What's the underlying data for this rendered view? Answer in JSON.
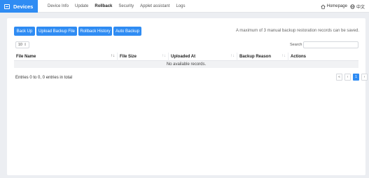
{
  "header": {
    "brand": "Devices",
    "nav": [
      "Device Info",
      "Update",
      "Rollback",
      "Security",
      "Applet assistant",
      "Logs"
    ],
    "active_nav": "Rollback",
    "homepage": "Homepage",
    "language": "中文"
  },
  "toolbar": {
    "back_up": "Back Up",
    "upload": "Upload Backup File",
    "history": "Rollback History",
    "auto": "Auto Backup",
    "notice": "A maximum of 3 manual backup restoration records can be saved."
  },
  "controls": {
    "page_size": "10",
    "search_label": "Search",
    "search_value": ""
  },
  "table": {
    "columns": [
      "File Name",
      "File Size",
      "Uploaded At",
      "Backup Reason",
      "Actions"
    ],
    "empty_text": "No available records."
  },
  "footer": {
    "entries_text": "Entries 0 to 0, 0 entries in total",
    "pager": {
      "first": "«",
      "prev": "‹",
      "current": "1",
      "next": "›"
    }
  },
  "colors": {
    "accent": "#2f8cf3",
    "background": "#eceef2"
  },
  "icons": [
    "devices-icon",
    "home-icon",
    "globe-icon",
    "sort-icon",
    "chevron-down-icon"
  ]
}
